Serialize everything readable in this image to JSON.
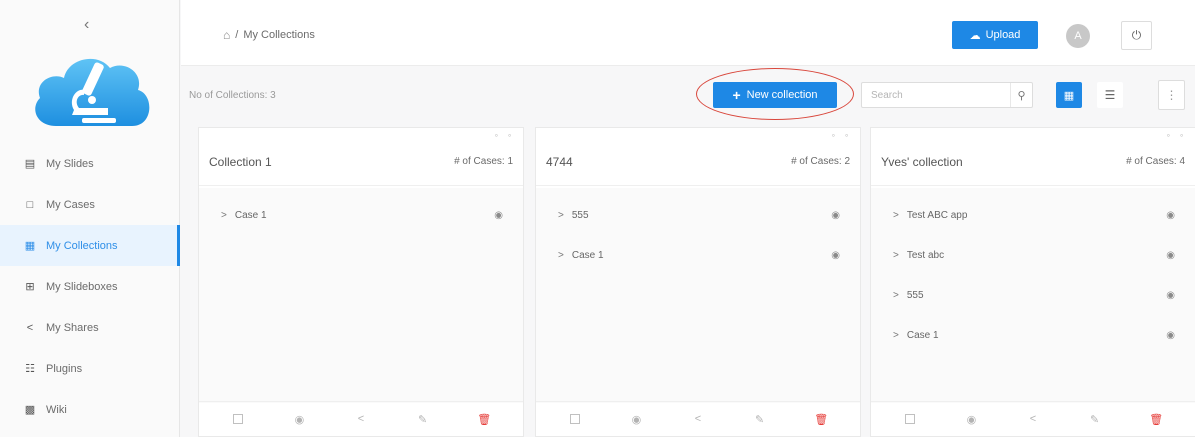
{
  "sidebar": {
    "collapse_icon": "chevron-left-icon",
    "logo_icon": "cloud-microscope-logo",
    "items": [
      {
        "label": "My Slides",
        "icon": "slides-icon"
      },
      {
        "label": "My Cases",
        "icon": "folder-icon"
      },
      {
        "label": "My Collections",
        "icon": "collections-icon",
        "active": true
      },
      {
        "label": "My Slideboxes",
        "icon": "slidebox-icon"
      },
      {
        "label": "My Shares",
        "icon": "share-icon"
      },
      {
        "label": "Plugins",
        "icon": "plugins-icon"
      },
      {
        "label": "Wiki",
        "icon": "wiki-icon"
      }
    ]
  },
  "header": {
    "breadcrumb_sep": "/",
    "breadcrumb_current": "My Collections",
    "upload_label": "Upload",
    "avatar_letter": "A"
  },
  "toolbar": {
    "count_label": "No of Collections: 3",
    "new_collection_label": "New collection",
    "search_placeholder": "Search"
  },
  "collections": [
    {
      "title": "Collection 1",
      "count_label": "# of Cases: 1",
      "cases": [
        "Case 1"
      ]
    },
    {
      "title": "4744",
      "count_label": "# of Cases: 2",
      "cases": [
        "555",
        "Case 1"
      ]
    },
    {
      "title": "Yves' collection",
      "count_label": "# of Cases: 4",
      "cases": [
        "Test ABC app",
        "Test abc",
        "555",
        "Case 1"
      ]
    }
  ],
  "colors": {
    "accent": "#1e88e5",
    "delete": "#e53935",
    "highlight_ring": "#d9473c"
  }
}
